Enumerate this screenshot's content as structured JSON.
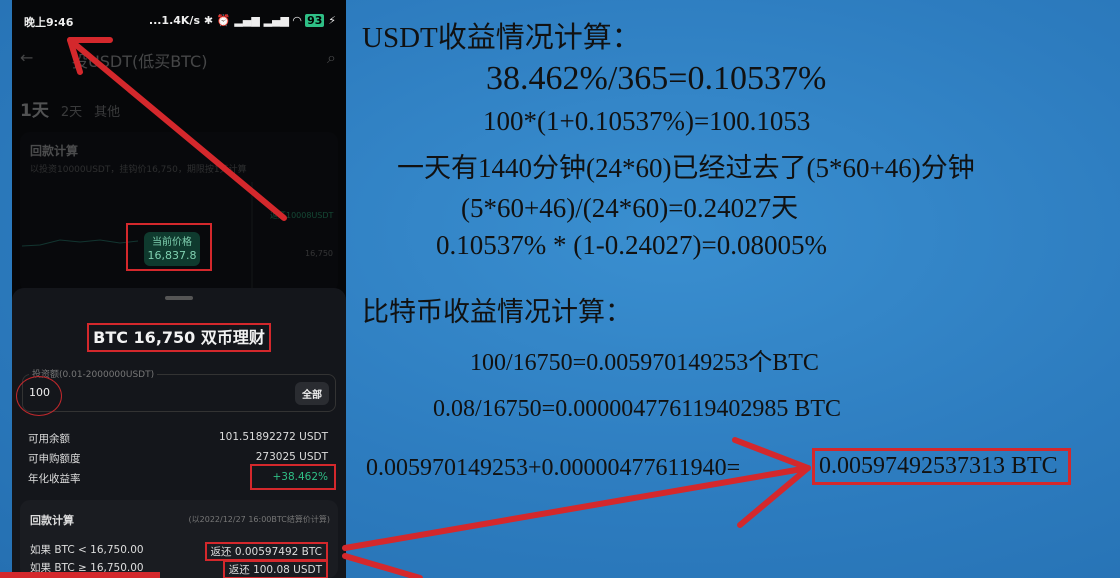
{
  "phone": {
    "status": {
      "time": "晚上9:46",
      "network": "...1.4K/s",
      "battery": "93"
    },
    "nav": {
      "title": "投USDT(低买BTC)"
    },
    "tabs": [
      {
        "label": "1天",
        "active": true
      },
      {
        "label": "2天"
      },
      {
        "label": "其他"
      }
    ],
    "chart_card": {
      "title": "回款计算",
      "subtitle": "以投资10000USDT，挂钩价16,750，期限按1天计算",
      "price_label": "当前价格",
      "price": "16,837.8",
      "right_label": "返还10008USDT",
      "strike": "16,750"
    },
    "sheet": {
      "title": "BTC 16,750 双币理财",
      "input_label": "投资额(0.01-2000000USDT)",
      "input_value": "100",
      "all_button": "全部",
      "rows": [
        {
          "label": "可用余额",
          "value": "101.51892272 USDT"
        },
        {
          "label": "可申购额度",
          "value": "273025 USDT"
        },
        {
          "label": "年化收益率",
          "value": "+38.462%"
        }
      ],
      "payout": {
        "title": "回款计算",
        "note": "(以2022/12/27 16:00BTC结算价计算)",
        "rows": [
          {
            "label": "如果 BTC < 16,750.00",
            "value": "返还 0.00597492 BTC"
          },
          {
            "label": "如果 BTC ≥ 16,750.00",
            "value": "返还 100.08 USDT"
          }
        ]
      }
    }
  },
  "slide": {
    "heading1": "USDT收益情况计算：",
    "lines1": [
      "38.462%/365=0.10537%",
      "100*(1+0.10537%)=100.1053",
      "一天有1440分钟(24*60)已经过去了(5*60+46)分钟",
      "(5*60+46)/(24*60)=0.24027天",
      "0.10537% * (1-0.24027)=0.08005%"
    ],
    "heading2": "比特币收益情况计算：",
    "lines2": [
      "100/16750=0.005970149253个BTC",
      "0.08/16750=0.000004776119402985 BTC"
    ],
    "final_left": "0.005970149253+0.00000477611940=",
    "final_result": "0.00597492537313 BTC"
  },
  "colors": {
    "annotation": "#d4282c",
    "background": "#2d7cbf",
    "positive": "#2fbf86"
  }
}
